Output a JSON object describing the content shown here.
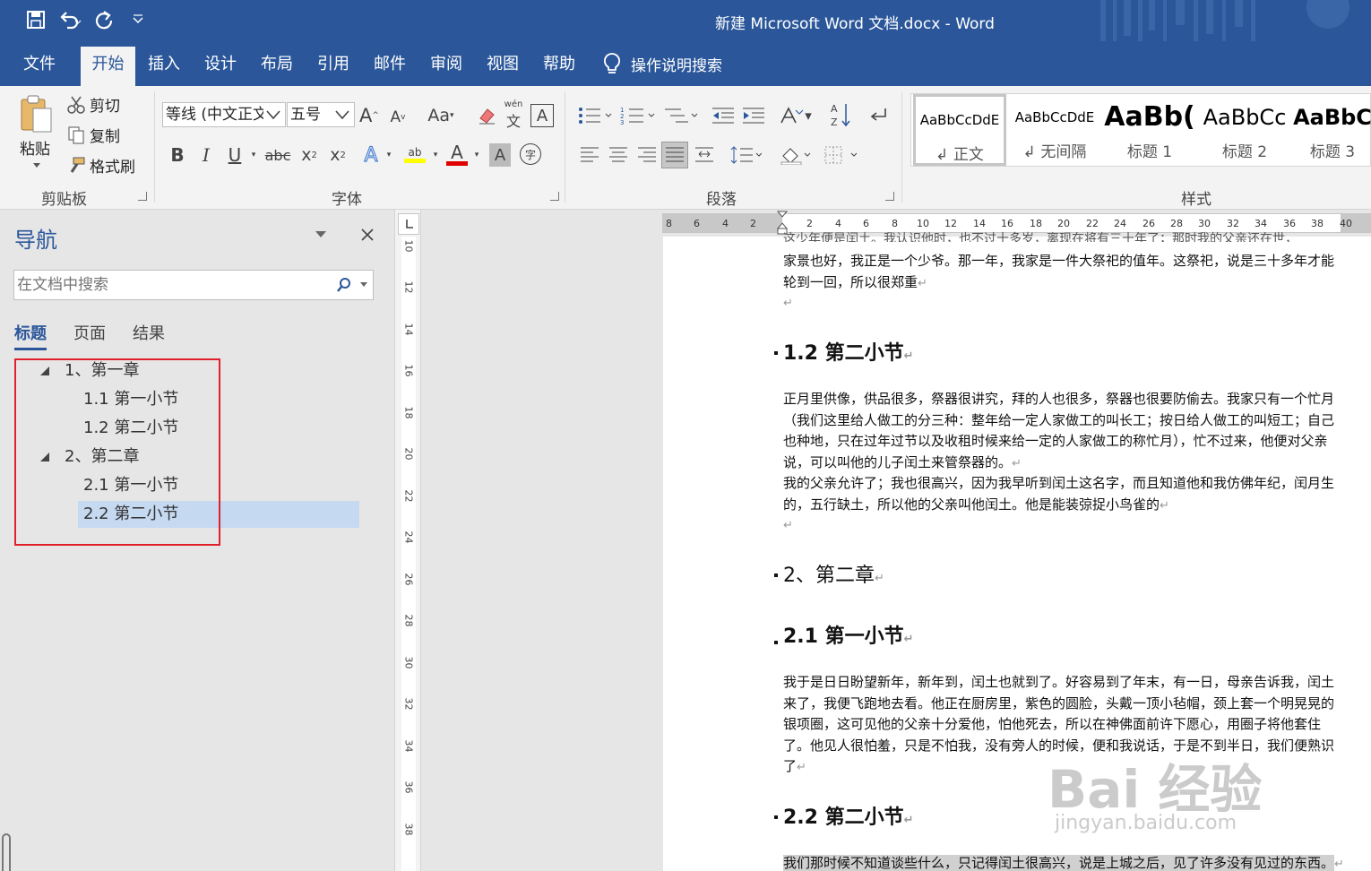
{
  "titlebar": {
    "title": "新建 Microsoft Word 文档.docx  -  Word"
  },
  "qat": {
    "icons": [
      "save-icon",
      "undo-icon",
      "redo-icon",
      "customize-qat-icon"
    ]
  },
  "tabs": [
    "文件",
    "开始",
    "插入",
    "设计",
    "布局",
    "引用",
    "邮件",
    "审阅",
    "视图",
    "帮助"
  ],
  "active_tab": "开始",
  "tellme": "操作说明搜索",
  "ribbon": {
    "clipboard": {
      "label": "剪贴板",
      "paste": "粘贴",
      "cut": "剪切",
      "copy": "复制",
      "format_painter": "格式刷"
    },
    "font": {
      "label": "字体",
      "font_name": "等线 (中文正文",
      "font_size": "五号",
      "grow": "A",
      "shrink": "A",
      "change_case": "Aa",
      "bold": "B",
      "italic": "I",
      "underline": "U",
      "strike": "abc",
      "subscript": "x",
      "superscript": "x",
      "phonetic": "wén",
      "char_border": "A",
      "font_color": "A",
      "char_shading": "A",
      "enclose": "字"
    },
    "paragraph": {
      "label": "段落"
    },
    "styles": {
      "label": "样式",
      "items": [
        {
          "sample": "AaBbCcDdE",
          "name": "↲ 正文"
        },
        {
          "sample": "AaBbCcDdE",
          "name": "↲ 无间隔"
        },
        {
          "sample": "AaBb(",
          "name": "标题 1"
        },
        {
          "sample": "AaBbCc",
          "name": "标题 2"
        },
        {
          "sample": "AaBbC",
          "name": "标题 3"
        }
      ]
    }
  },
  "nav": {
    "title": "导航",
    "search_placeholder": "在文档中搜索",
    "tabs": [
      "标题",
      "页面",
      "结果"
    ],
    "tree": [
      {
        "text": "1、第一章",
        "level": 1
      },
      {
        "text": "1.1 第一小节",
        "level": 2
      },
      {
        "text": "1.2 第二小节",
        "level": 2
      },
      {
        "text": "2、第二章",
        "level": 1
      },
      {
        "text": "2.1 第一小节",
        "level": 2
      },
      {
        "text": "2.2 第二小节",
        "level": 2,
        "selected": true
      }
    ]
  },
  "vruler_numbers": [
    "10",
    "12",
    "14",
    "16",
    "18",
    "20",
    "22",
    "24",
    "26",
    "28",
    "30",
    "32",
    "34",
    "36",
    "38"
  ],
  "hruler_numbers": [
    "8",
    "6",
    "4",
    "2",
    "2",
    "2",
    "4",
    "6",
    "8",
    "10",
    "12",
    "14",
    "16",
    "18",
    "20",
    "22",
    "24",
    "26",
    "28",
    "30",
    "32",
    "34",
    "36",
    "38",
    "40"
  ],
  "document": {
    "top_partial": "这少年便是闰土。我认识他时，也不过十多岁，离现在将有三十年了；那时我的父亲还在世，",
    "p0": "家景也好，我正是一个少爷。那一年，我家是一件大祭祀的值年。这祭祀，说是三十多年才能轮到一回，所以很郑重",
    "h_1_2": "1.2  第二小节",
    "p1": "正月里供像，供品很多，祭器很讲究，拜的人也很多，祭器也很要防偷去。我家只有一个忙月（我们这里给人做工的分三种：整年给一定人家做工的叫长工；按日给人做工的叫短工；自己也种地，只在过年过节以及收租时候来给一定的人家做工的称忙月），忙不过来，他便对父亲说，可以叫他的儿子闰土来管祭器的。",
    "p2": "我的父亲允许了；我也很高兴，因为我早听到闰土这名字，而且知道他和我仿佛年纪，闰月生的，五行缺土，所以他的父亲叫他闰土。他是能装弶捉小鸟雀的",
    "h_2": "2、第二章",
    "h_2_1": "2.1  第一小节",
    "p3": "我于是日日盼望新年，新年到，闰土也就到了。好容易到了年末，有一日，母亲告诉我，闰土来了，我便飞跑地去看。他正在厨房里，紫色的圆脸，头戴一顶小毡帽，颈上套一个明晃晃的银项圈，这可见他的父亲十分爱他，怕他死去，所以在神佛面前许下愿心，用圈子将他套住了。他见人很怕羞，只是不怕我，没有旁人的时候，便和我说话，于是不到半日，我们便熟识了",
    "h_2_2": "2.2  第二小节",
    "p4": "我们那时候不知道谈些什么，只记得闰土很高兴，说是上城之后，见了许多没有见过的东西。",
    "para_mark": "↵"
  },
  "watermark": {
    "brand": "Bai 经验",
    "url": "jingyan.baidu.com"
  },
  "colors": {
    "brand": "#2b579a",
    "ribbon_bg": "#f3f3f3",
    "nav_selected": "#c5d9f1",
    "annotation_box": "#e0202a"
  }
}
